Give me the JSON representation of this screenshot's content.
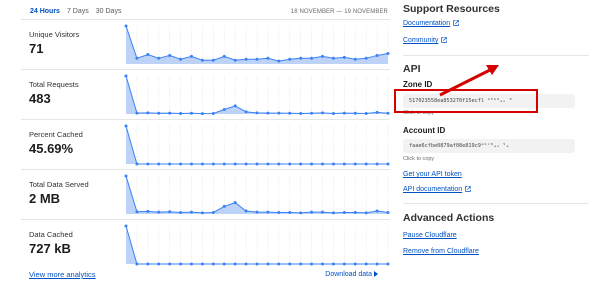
{
  "range_tabs": [
    {
      "label": "24 Hours",
      "active": true
    },
    {
      "label": "7 Days",
      "active": false
    },
    {
      "label": "30 Days",
      "active": false
    }
  ],
  "date_range": "18 NOVEMBER — 19 NOVEMBER",
  "metrics": [
    {
      "label": "Unique Visitors",
      "value": "71"
    },
    {
      "label": "Total Requests",
      "value": "483"
    },
    {
      "label": "Percent Cached",
      "value": "45.69%"
    },
    {
      "label": "Total Data Served",
      "value": "2 MB"
    },
    {
      "label": "Data Cached",
      "value": "727 kB"
    }
  ],
  "view_more": "View more analytics",
  "download": "Download data",
  "sidebar": {
    "support_heading": "Support Resources",
    "documentation": "Documentation",
    "community": "Community",
    "api_heading": "API",
    "zone_id_label": "Zone ID",
    "zone_id_value": "517023558ea853270f15ecfl ᵃ⁵ᵇ⁹ₐᵤ ⁸ ",
    "click_to_copy": "Click to copy",
    "account_id_label": "Account ID",
    "account_id_value": "faae6cfbe0879af08e819c9ᵃᵇᶜ⁸ₐᵤ ⁵ₐ",
    "get_token": "Get your API token",
    "api_docs": "API documentation",
    "advanced_heading": "Advanced Actions",
    "pause": "Pause Cloudflare",
    "remove": "Remove from Cloudflare"
  },
  "colors": {
    "accent": "#0051c3",
    "chart_line": "#3b82f6",
    "chart_fill": "#bcd3f7",
    "highlight": "#d50000"
  },
  "chart_data": [
    {
      "type": "area",
      "title": "Unique Visitors",
      "x": [
        1,
        2,
        3,
        4,
        5,
        6,
        7,
        8,
        9,
        10,
        11,
        12,
        13,
        14,
        15,
        16,
        17,
        18,
        19,
        20,
        21,
        22,
        23,
        24,
        25
      ],
      "values": [
        40,
        6,
        10,
        6,
        9,
        5,
        8,
        4,
        4,
        8,
        4,
        5,
        5,
        6,
        3,
        5,
        6,
        6,
        8,
        6,
        7,
        5,
        6,
        9,
        11
      ]
    },
    {
      "type": "area",
      "title": "Total Requests",
      "x": [
        1,
        2,
        3,
        4,
        5,
        6,
        7,
        8,
        9,
        10,
        11,
        12,
        13,
        14,
        15,
        16,
        17,
        18,
        19,
        20,
        21,
        22,
        23,
        24,
        25
      ],
      "values": [
        210,
        5,
        6,
        4,
        5,
        3,
        4,
        2,
        3,
        25,
        45,
        12,
        6,
        5,
        5,
        4,
        3,
        4,
        6,
        3,
        5,
        4,
        3,
        9,
        4
      ]
    },
    {
      "type": "area",
      "title": "Percent Cached",
      "x": [
        1,
        2,
        3,
        4,
        5,
        6,
        7,
        8,
        9,
        10,
        11,
        12,
        13,
        14,
        15,
        16,
        17,
        18,
        19,
        20,
        21,
        22,
        23,
        24,
        25
      ],
      "values": [
        100,
        0,
        0,
        0,
        0,
        0,
        0,
        0,
        0,
        0,
        0,
        0,
        0,
        0,
        0,
        0,
        0,
        0,
        0,
        0,
        0,
        0,
        0,
        0,
        0
      ]
    },
    {
      "type": "area",
      "title": "Total Data Served",
      "x": [
        1,
        2,
        3,
        4,
        5,
        6,
        7,
        8,
        9,
        10,
        11,
        12,
        13,
        14,
        15,
        16,
        17,
        18,
        19,
        20,
        21,
        22,
        23,
        24,
        25
      ],
      "values": [
        100,
        6,
        7,
        5,
        6,
        4,
        5,
        3,
        4,
        20,
        30,
        8,
        5,
        5,
        4,
        4,
        3,
        5,
        5,
        3,
        4,
        4,
        3,
        8,
        4
      ]
    },
    {
      "type": "area",
      "title": "Data Cached",
      "x": [
        1,
        2,
        3,
        4,
        5,
        6,
        7,
        8,
        9,
        10,
        11,
        12,
        13,
        14,
        15,
        16,
        17,
        18,
        19,
        20,
        21,
        22,
        23,
        24,
        25
      ],
      "values": [
        100,
        0,
        0,
        0,
        0,
        0,
        0,
        0,
        0,
        0,
        0,
        0,
        0,
        0,
        0,
        0,
        0,
        0,
        0,
        0,
        0,
        0,
        0,
        0,
        0
      ]
    }
  ]
}
